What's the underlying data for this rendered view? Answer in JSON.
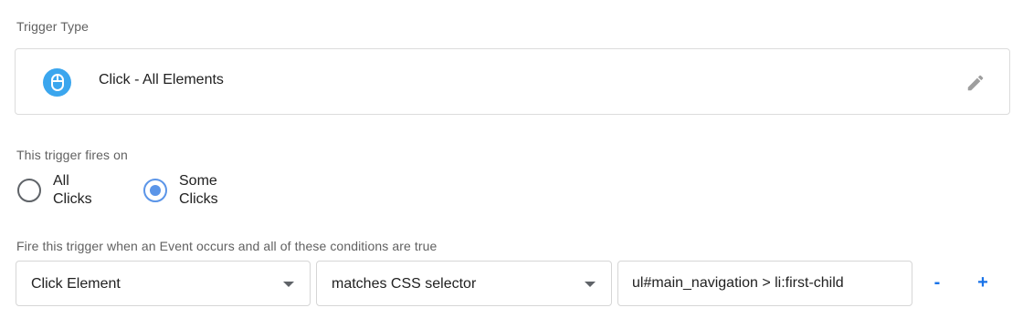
{
  "trigger_type": {
    "label": "Trigger Type",
    "name": "Click - All Elements",
    "icon": "mouse-icon",
    "icon_color": "#3ba6ee",
    "edit_icon": "pencil-icon"
  },
  "fires_on": {
    "label": "This trigger fires on",
    "options": [
      {
        "label": "All Clicks",
        "checked": false
      },
      {
        "label": "Some Clicks",
        "checked": true
      }
    ],
    "accent_color": "#5b95e8"
  },
  "conditions": {
    "label": "Fire this trigger when an Event occurs and all of these conditions are true",
    "variable": "Click Element",
    "operator": "matches CSS selector",
    "value": "ul#main_navigation > li:first-child",
    "remove_label": "-",
    "add_label": "+",
    "action_color": "#1a73e8"
  }
}
